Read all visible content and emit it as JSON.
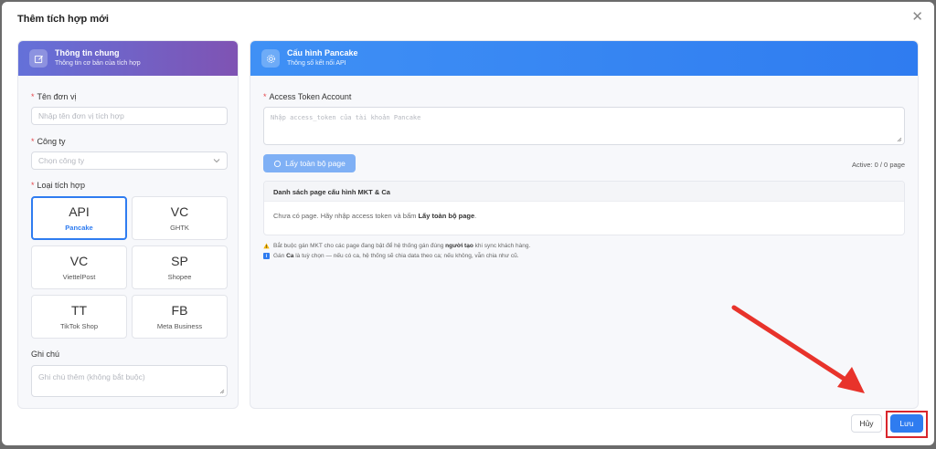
{
  "modal": {
    "title": "Thêm tích hợp mới",
    "close_label": "✕"
  },
  "left_panel": {
    "title": "Thông tin chung",
    "subtitle": "Thông tin cơ bản của tích hợp",
    "unit_name": {
      "label": "Tên đơn vị",
      "placeholder": "Nhập tên đơn vị tích hợp"
    },
    "company": {
      "label": "Công ty",
      "placeholder": "Chọn công ty"
    },
    "integration_type": {
      "label": "Loại tích hợp",
      "options": [
        {
          "code": "API",
          "name": "Pancake",
          "selected": true
        },
        {
          "code": "VC",
          "name": "GHTK",
          "selected": false
        },
        {
          "code": "VC",
          "name": "ViettelPost",
          "selected": false
        },
        {
          "code": "SP",
          "name": "Shopee",
          "selected": false
        },
        {
          "code": "TT",
          "name": "TikTok Shop",
          "selected": false
        },
        {
          "code": "FB",
          "name": "Meta Business",
          "selected": false
        }
      ]
    },
    "note": {
      "label": "Ghi chú",
      "placeholder": "Ghi chú thêm (không bắt buộc)"
    }
  },
  "right_panel": {
    "title": "Cấu hình Pancake",
    "subtitle": "Thông số kết nối API",
    "token": {
      "label": "Access Token Account",
      "placeholder": "Nhập access_token của tài khoản Pancake"
    },
    "fetch_button": "Lấy toàn bộ page",
    "active_count": "Active: 0 / 0 page",
    "page_list": {
      "title": "Danh sách page cấu hình MKT & Ca",
      "empty_prefix": "Chưa có page. Hãy nhập access token và bấm ",
      "empty_action": "Lấy toàn bộ page",
      "empty_suffix": "."
    },
    "warning_note": {
      "prefix": "Bắt buộc gán MKT cho các page đang bật để hệ thống gán đúng ",
      "bold": "người tạo",
      "suffix": " khi sync khách hàng."
    },
    "info_note": {
      "prefix": "Gán ",
      "bold": "Ca",
      "suffix": " là tuỳ chọn — nếu có ca, hệ thống sẽ chia data theo ca; nếu không, vẫn chia như cũ."
    }
  },
  "footer": {
    "cancel_label": "Hủy",
    "save_label": "Lưu"
  },
  "colors": {
    "primary": "#2f7cf0",
    "left_header_start": "#6471d9",
    "left_header_end": "#7f53b3",
    "annotation_red": "#d9262c",
    "required": "#e5484d"
  }
}
